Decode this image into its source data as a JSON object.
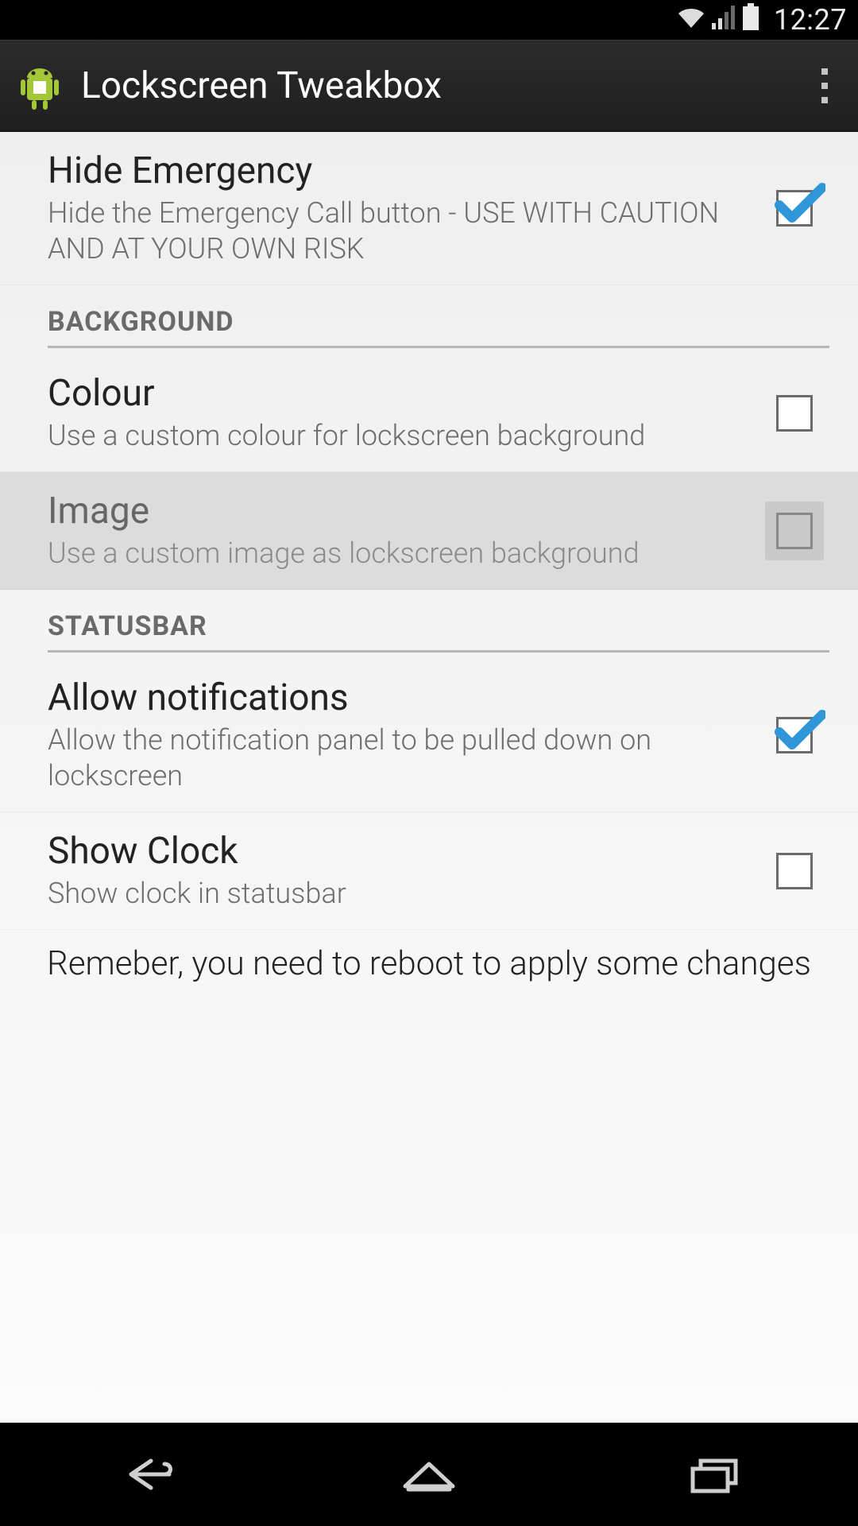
{
  "statusbar": {
    "time": "12:27"
  },
  "actionbar": {
    "title": "Lockscreen Tweakbox"
  },
  "sections": {
    "hide_emergency": {
      "title": "Hide Emergency",
      "summary": "Hide the Emergency Call button - USE WITH CAUTION AND AT YOUR OWN RISK",
      "checked": true
    },
    "background_header": "BACKGROUND",
    "colour": {
      "title": "Colour",
      "summary": "Use a custom colour for lockscreen background",
      "checked": false
    },
    "image": {
      "title": "Image",
      "summary": "Use a custom image as lockscreen background",
      "checked": false
    },
    "statusbar_header": "STATUSBAR",
    "allow_notifications": {
      "title": "Allow notifications",
      "summary": "Allow the notification panel to be pulled down on lockscreen",
      "checked": true
    },
    "show_clock": {
      "title": "Show Clock",
      "summary": "Show clock in statusbar",
      "checked": false
    }
  },
  "footer_note": "Remeber, you need to reboot to apply some changes"
}
